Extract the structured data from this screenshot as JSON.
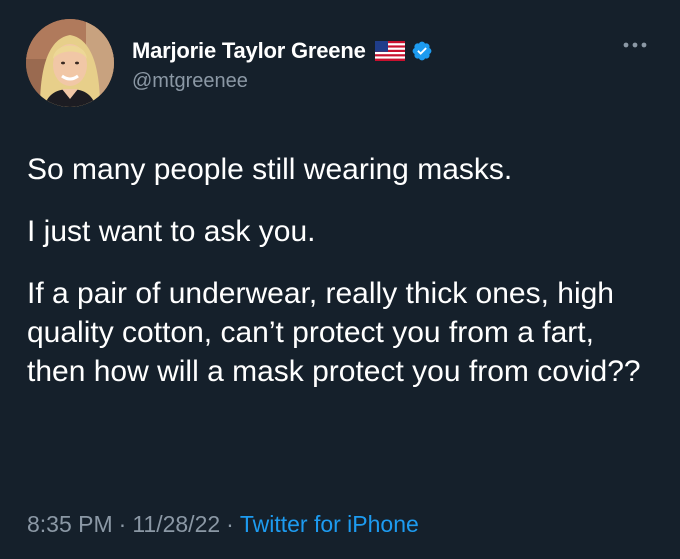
{
  "author": {
    "display_name": "Marjorie Taylor Greene",
    "handle": "@mtgreenee",
    "flag_icon": "us-flag-icon",
    "verified_icon": "verified-badge-icon",
    "avatar_icon": "profile-photo"
  },
  "menu": {
    "icon": "more-options-icon"
  },
  "tweet": {
    "paragraphs": [
      "So many people still wearing masks.",
      "I just want to ask you.",
      "If a pair of underwear, really thick ones, high quality cotton, can’t protect you from a fart, then how will a mask protect you from covid??"
    ]
  },
  "meta": {
    "time": "8:35 PM",
    "separator": "·",
    "date": "11/28/22",
    "source": "Twitter for iPhone"
  },
  "colors": {
    "background": "#15202b",
    "primary_text": "#ffffff",
    "secondary_text": "#8b98a5",
    "accent": "#1d9bf0"
  }
}
